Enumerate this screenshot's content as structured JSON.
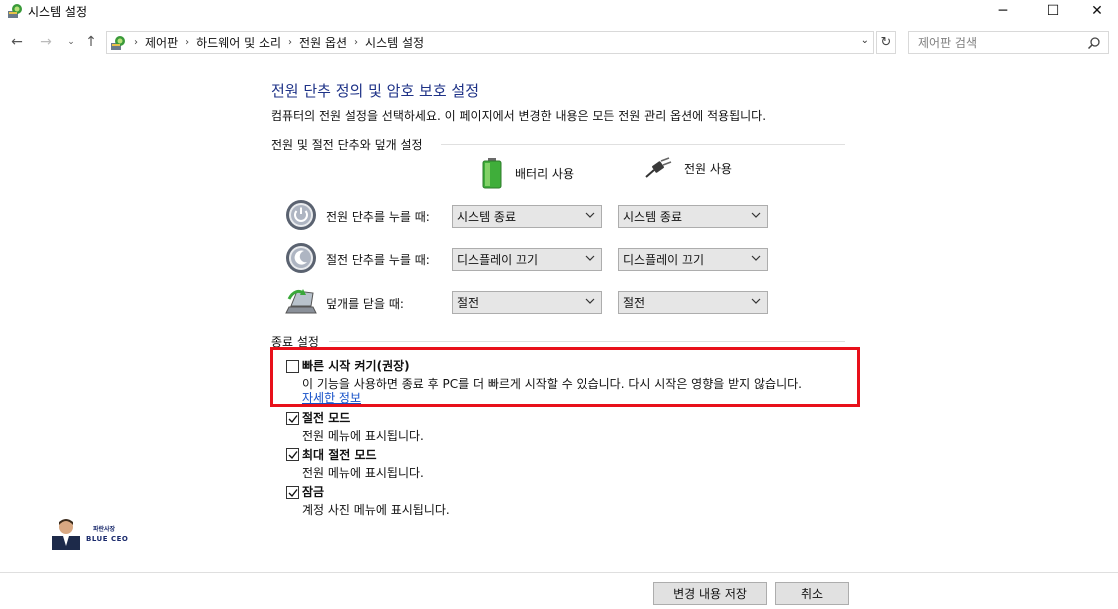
{
  "window": {
    "title": "시스템 설정",
    "minimize_glyph": "─",
    "maximize_glyph": "☐",
    "close_glyph": "✕"
  },
  "nav": {
    "back_glyph": "←",
    "forward_glyph": "→",
    "recent_glyph": "⌄",
    "up_glyph": "↑",
    "breadcrumbs": [
      "제어판",
      "하드웨어 및 소리",
      "전원 옵션",
      "시스템 설정"
    ],
    "separator": "›",
    "dropdown_glyph": "⌄",
    "refresh_glyph": "↻",
    "search_placeholder": "제어판 검색"
  },
  "main": {
    "title": "전원 단추 정의 및 암호 보호 설정",
    "description": "컴퓨터의 전원 설정을 선택하세요. 이 페이지에서 변경한 내용은 모든 전원 관리 옵션에 적용됩니다.",
    "power_section_header": "전원 및 절전 단추와 덮개 설정",
    "columns": {
      "battery": "배터리 사용",
      "plugged": "전원 사용"
    },
    "rows": [
      {
        "label": "전원 단추를 누를 때:",
        "battery": "시스템 종료",
        "plugged": "시스템 종료",
        "icon": "power-button-icon"
      },
      {
        "label": "절전 단추를 누를 때:",
        "battery": "디스플레이 끄기",
        "plugged": "디스플레이 끄기",
        "icon": "sleep-button-icon"
      },
      {
        "label": "덮개를 닫을 때:",
        "battery": "절전",
        "plugged": "절전",
        "icon": "laptop-lid-icon"
      }
    ],
    "shutdown_section_header": "종료 설정",
    "shutdown_options": [
      {
        "title": "빠른 시작 켜기(권장)",
        "checked": false,
        "description": "이 기능을 사용하면 종료 후 PC를 더 빠르게 시작할 수 있습니다. 다시 시작은 영향을 받지 않습니다.",
        "link": "자세한 정보"
      },
      {
        "title": "절전 모드",
        "checked": true,
        "description": "전원 메뉴에 표시됩니다."
      },
      {
        "title": "최대 절전 모드",
        "checked": true,
        "description": "전원 메뉴에 표시됩니다."
      },
      {
        "title": "잠금",
        "checked": true,
        "description": "계정 사진 메뉴에 표시됩니다."
      }
    ]
  },
  "watermark": {
    "line1": "파란사장",
    "line2": "BLUE CEO"
  },
  "footer": {
    "save_label": "변경 내용 저장",
    "cancel_label": "취소"
  },
  "colors": {
    "title_blue": "#1e3287",
    "link_blue": "#1550c8",
    "highlight_red": "#e8101a"
  }
}
